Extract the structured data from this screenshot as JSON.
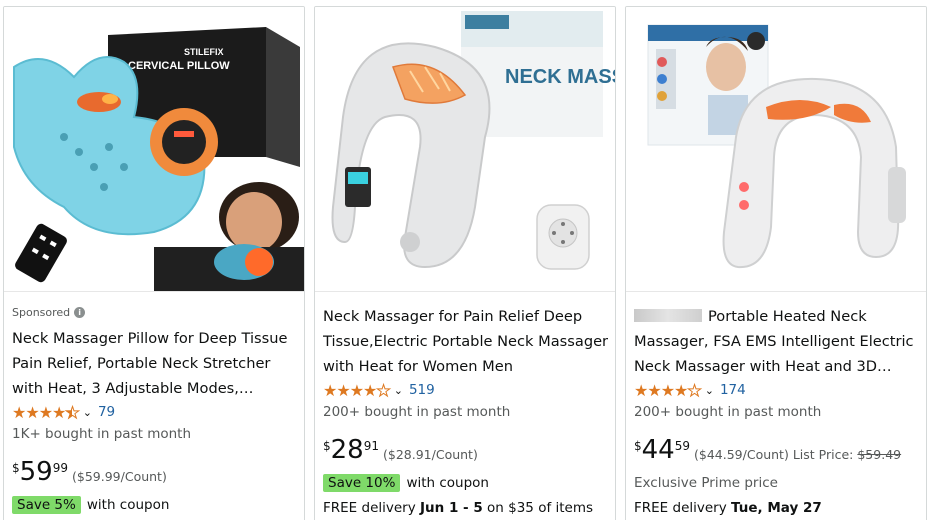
{
  "products": [
    {
      "sponsored": "Sponsored",
      "title": "Neck Massager Pillow for Deep Tissue Pain Relief, Portable Neck Stretcher with Heat, 3 Adjustable Modes,…",
      "image_box_text": "CERVICAL PILLOW",
      "image_brand_text": "STILEFIX",
      "rating": 4.5,
      "rating_count": "79",
      "bought": "1K+ bought in past month",
      "price_symbol": "$",
      "price_whole": "59",
      "price_fraction": "99",
      "price_per_unit": "($59.99/Count)",
      "coupon_badge": "Save 5%",
      "coupon_text": "with coupon"
    },
    {
      "title": "Neck Massager for Pain Relief Deep Tissue,Electric Portable Neck Massager with Heat for Women Men",
      "image_box_text": "NECK MASSAGER",
      "rating": 4,
      "rating_count": "519",
      "bought": "200+ bought in past month",
      "price_symbol": "$",
      "price_whole": "28",
      "price_fraction": "91",
      "price_per_unit": "($28.91/Count)",
      "coupon_badge": "Save 10%",
      "coupon_text": "with coupon",
      "delivery_prefix": "FREE delivery ",
      "delivery_date": "Jun 1 - 5",
      "delivery_suffix": " on $35 of items"
    },
    {
      "title_rest": "Portable Heated Neck Massager, FSA EMS Intelligent Electric Neck Massager with Heat and 3D…",
      "rating": 4,
      "rating_count": "174",
      "bought": "200+ bought in past month",
      "price_symbol": "$",
      "price_whole": "44",
      "price_fraction": "59",
      "price_per_unit": "($44.59/Count)",
      "list_price_label": "List Price:",
      "list_price": "$59.49",
      "prime_text": "Exclusive Prime price",
      "delivery_prefix": "FREE delivery ",
      "delivery_date": "Tue, May 27"
    }
  ],
  "colors": {
    "star": "#de7921",
    "link": "#2162a1",
    "coupon_bg": "#7fda69",
    "muted": "#565959"
  }
}
